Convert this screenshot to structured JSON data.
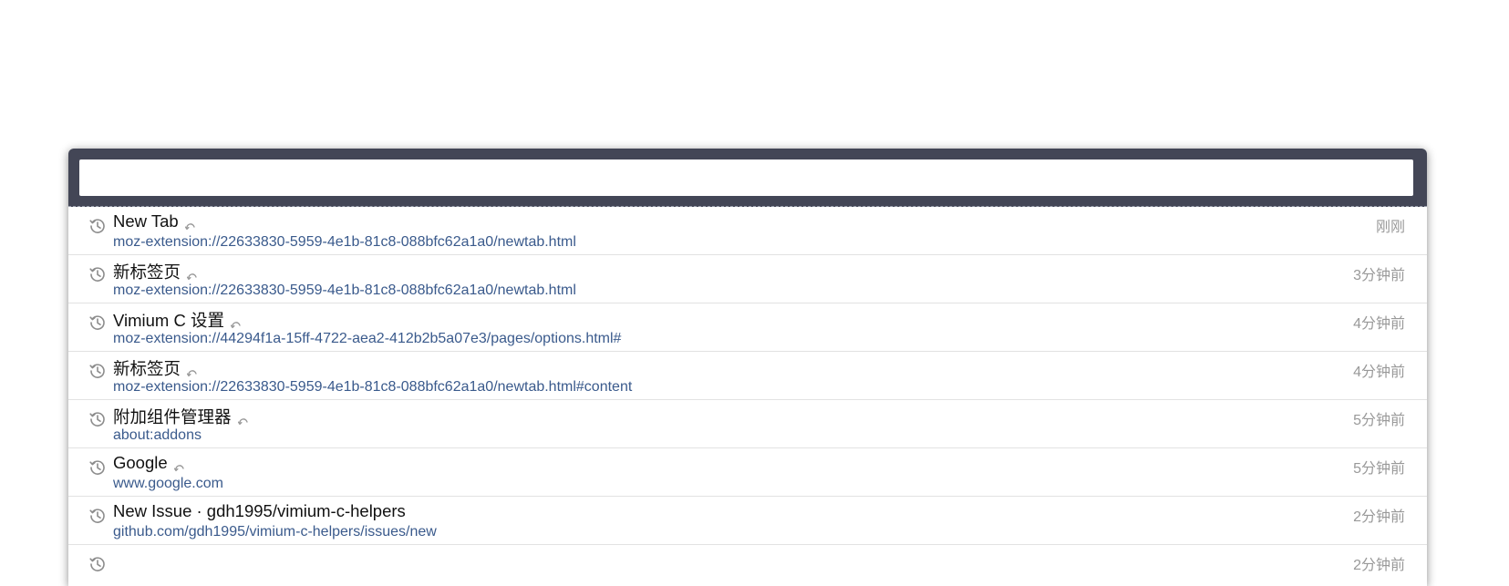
{
  "search": {
    "value": "",
    "placeholder": ""
  },
  "items": [
    {
      "title": "New Tab",
      "url": "moz-extension://22633830-5959-4e1b-81c8-088bfc62a1a0/newtab.html",
      "time": "刚刚",
      "tab_indicator": true,
      "icon": "history-icon"
    },
    {
      "title": "新标签页",
      "url": "moz-extension://22633830-5959-4e1b-81c8-088bfc62a1a0/newtab.html",
      "time": "3分钟前",
      "tab_indicator": true,
      "icon": "history-icon"
    },
    {
      "title": "Vimium C 设置",
      "url": "moz-extension://44294f1a-15ff-4722-aea2-412b2b5a07e3/pages/options.html#",
      "time": "4分钟前",
      "tab_indicator": true,
      "icon": "history-icon"
    },
    {
      "title": "新标签页",
      "url": "moz-extension://22633830-5959-4e1b-81c8-088bfc62a1a0/newtab.html#content",
      "time": "4分钟前",
      "tab_indicator": true,
      "icon": "history-icon"
    },
    {
      "title": "附加组件管理器",
      "url": "about:addons",
      "time": "5分钟前",
      "tab_indicator": true,
      "icon": "history-icon"
    },
    {
      "title": "Google",
      "url": "www.google.com",
      "time": "5分钟前",
      "tab_indicator": true,
      "icon": "history-icon"
    },
    {
      "title": "New Issue · gdh1995/vimium-c-helpers",
      "url": "github.com/gdh1995/vimium-c-helpers/issues/new",
      "time": "2分钟前",
      "tab_indicator": false,
      "icon": "history-icon"
    },
    {
      "title": "",
      "url": "",
      "time": "2分钟前",
      "tab_indicator": false,
      "icon": "history-icon"
    }
  ],
  "colors": {
    "bar_background": "#434656",
    "url_text": "#3a5a8c",
    "time_text": "#999999",
    "title_text": "#111111"
  }
}
